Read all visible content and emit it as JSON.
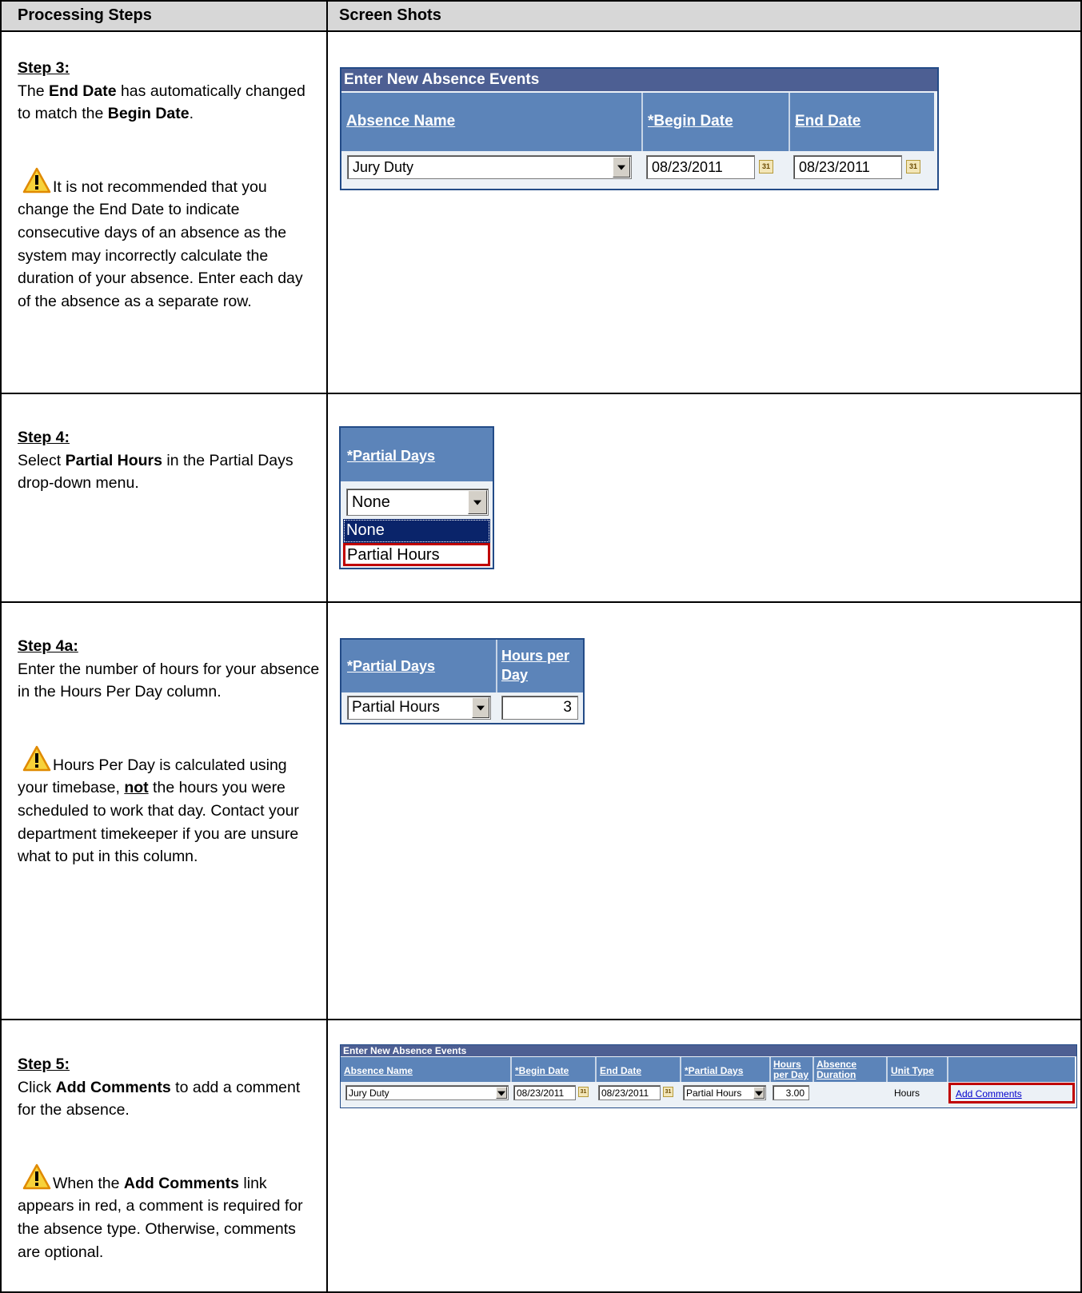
{
  "header": {
    "col1": "Processing Steps",
    "col2": "Screen Shots"
  },
  "steps": [
    {
      "title": "Step 3:",
      "p1_a": "The ",
      "p1_b": "End Date",
      "p1_c": " has automatically changed to match the ",
      "p1_d": "Begin Date",
      "p1_e": ".",
      "note": "It is not recommended that you change the End Date to indicate consecutive days of an absence as the system may incorrectly calculate the duration of your absence. Enter each day of the absence as a separate row."
    },
    {
      "title": "Step 4:",
      "p1_a": "Select ",
      "p1_b": "Partial Hours",
      "p1_c": " in the Partial Days drop-down menu."
    },
    {
      "title": "Step 4a:",
      "p1": "Enter the number of hours for your absence in the Hours Per Day column.",
      "note_a": "Hours Per Day is calculated using your timebase, ",
      "note_b": "not",
      "note_c": " the hours you were scheduled to work that day. Contact your department timekeeper if you are unsure what to put in this column."
    },
    {
      "title": "Step 5:",
      "p1_a": "Click ",
      "p1_b": "Add Comments",
      "p1_c": " to add a comment for the absence.",
      "note_a": "When the ",
      "note_b": "Add Comments",
      "note_c": " link appears in red, a comment is required for the absence type. Otherwise, comments are optional."
    }
  ],
  "shot1": {
    "caption": "Enter New Absence Events",
    "col_absence": "Absence Name",
    "col_begin": "*Begin Date",
    "col_end": "End Date",
    "absence_value": "Jury Duty",
    "begin_value": "08/23/2011",
    "end_value": "08/23/2011",
    "cal_label": "31"
  },
  "shot2": {
    "col_partial": "*Partial Days",
    "selected": "None",
    "options": [
      "None",
      "Partial Hours"
    ]
  },
  "shot3": {
    "col_partial": "*Partial Days",
    "col_hours": "Hours per Day",
    "partial_value": "Partial Hours",
    "hours_value": "3"
  },
  "shot4": {
    "caption": "Enter New Absence Events",
    "col_absence": "Absence Name",
    "col_begin": "*Begin Date",
    "col_end": "End Date",
    "col_partial": "*Partial Days",
    "col_hours": "Hours per Day",
    "col_duration": "Absence Duration",
    "col_unit": "Unit Type",
    "absence_value": "Jury Duty",
    "begin_value": "08/23/2011",
    "end_value": "08/23/2011",
    "partial_value": "Partial Hours",
    "hours_value": "3.00",
    "unit_value": "Hours",
    "link": "Add Comments",
    "cal_label": "31"
  },
  "colors": {
    "caption_bg": "#4d5f93",
    "header_bg": "#5c84b9",
    "grid_bg": "#ecf1f6",
    "highlight": "#c00000",
    "link": "#0000cc",
    "selected_option": "#0a246a"
  },
  "icons": [
    "warning-icon",
    "calendar-icon",
    "dropdown-arrow-icon"
  ]
}
